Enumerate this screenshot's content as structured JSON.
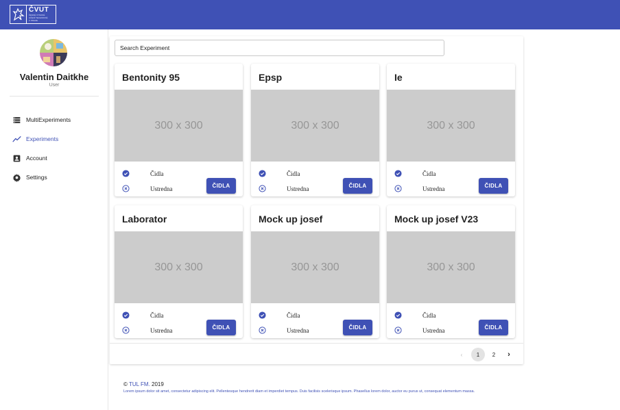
{
  "brand": {
    "logo_text": "ČVUT",
    "logo_subtext": [
      "ČESKÉ VYSOKÉ",
      "UČENÍ TECHNICKÉ",
      "V PRAZE"
    ]
  },
  "user": {
    "name": "Valentin Daitkhe",
    "role": "User"
  },
  "nav": [
    {
      "label": "MultiExperiments",
      "icon": "list-icon",
      "active": false
    },
    {
      "label": "Experiments",
      "icon": "trending-icon",
      "active": true
    },
    {
      "label": "Account",
      "icon": "account-box-icon",
      "active": false
    },
    {
      "label": "Settings",
      "icon": "gear-icon",
      "active": false
    }
  ],
  "search": {
    "placeholder": "Search Experiment",
    "value": ""
  },
  "experiments": [
    {
      "title": "Bentonity 95",
      "image_label": "300 x 300",
      "row1": "Čidla",
      "row2": "Ustredna",
      "button": "ČIDLA"
    },
    {
      "title": "Epsp",
      "image_label": "300 x 300",
      "row1": "Čidla",
      "row2": "Ustredna",
      "button": "ČIDLA"
    },
    {
      "title": "Ie",
      "image_label": "300 x 300",
      "row1": "Čidla",
      "row2": "Ustredna",
      "button": "ČIDLA"
    },
    {
      "title": "Laborator",
      "image_label": "300 x 300",
      "row1": "Čidla",
      "row2": "Ustredna",
      "button": "ČIDLA"
    },
    {
      "title": "Mock up josef",
      "image_label": "300 x 300",
      "row1": "Čidla",
      "row2": "Ustredna",
      "button": "ČIDLA"
    },
    {
      "title": "Mock up josef V23",
      "image_label": "300 x 300",
      "row1": "Čidla",
      "row2": "Ustredna",
      "button": "ČIDLA"
    }
  ],
  "pagination": {
    "prev": "‹",
    "pages": [
      "1",
      "2"
    ],
    "current": "1",
    "next": "›"
  },
  "footer": {
    "copyright_symbol": "©",
    "brand": "TUL FM.",
    "year": "2019",
    "lorem": "Lorem ipsum dolor sit amet, consectetur adipiscing elit. Pellentesque hendrerit diam et imperdiet tempus. Duis facilisis scelerisque ipsum. Phasellus lorem dolor, auctor eu purus ut, consequat elementum massa."
  },
  "colors": {
    "primary": "#3f51b5",
    "check_ok": "#3f51b5",
    "placeholder_gray": "#cccccc"
  }
}
